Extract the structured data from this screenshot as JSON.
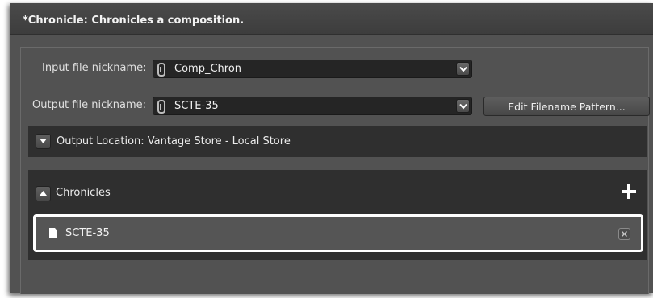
{
  "window": {
    "title": "*Chronicle: Chronicles a composition."
  },
  "input_field": {
    "label": "Input file nickname:",
    "value": "Comp_Chron"
  },
  "output_field": {
    "label": "Output file nickname:",
    "value": "SCTE-35"
  },
  "edit_button": {
    "label": "Edit Filename Pattern..."
  },
  "output_location": {
    "label": "Output Location: Vantage Store - Local Store",
    "expanded": false
  },
  "chronicles": {
    "label": "Chronicles",
    "expanded": true,
    "items": [
      {
        "label": "SCTE-35"
      }
    ]
  },
  "colors": {
    "panel_bg": "#525252",
    "section_bg": "#2f2f2f",
    "combo_bg": "#252525",
    "selected_border": "#ffffff"
  }
}
